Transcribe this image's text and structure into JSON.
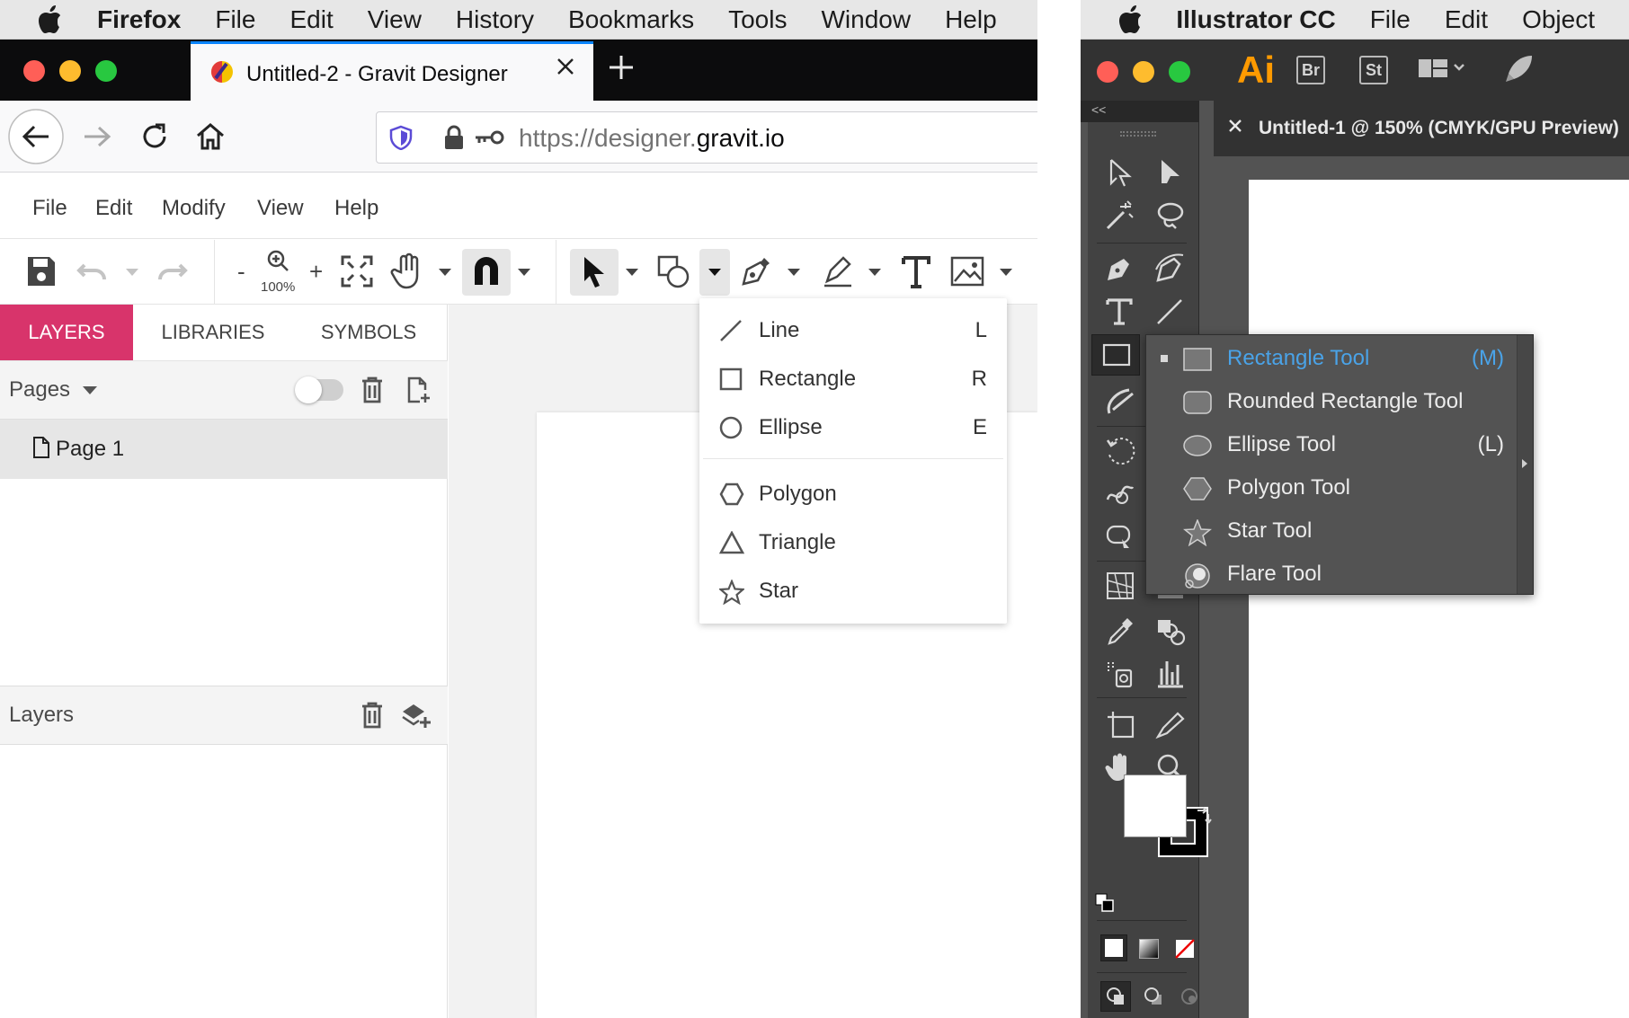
{
  "firefox": {
    "menubar": {
      "app": "Firefox",
      "items": [
        "File",
        "Edit",
        "View",
        "History",
        "Bookmarks",
        "Tools",
        "Window",
        "Help"
      ]
    },
    "tab": {
      "title": "Untitled-2 - Gravit Designer"
    },
    "url": {
      "prefix": "https://designer.",
      "domain": "gravit.io"
    }
  },
  "gravit": {
    "menu": [
      "File",
      "Edit",
      "Modify",
      "View",
      "Help"
    ],
    "zoom": "100%",
    "zoom_minus": "-",
    "zoom_plus": "+",
    "panel_tabs": [
      "LAYERS",
      "LIBRARIES",
      "SYMBOLS"
    ],
    "pages_label": "Pages",
    "page_item": "Page 1",
    "layers_label": "Layers",
    "accent": "#d8346b",
    "shape_menu": [
      {
        "label": "Line",
        "key": "L",
        "icon": "line-icon"
      },
      {
        "label": "Rectangle",
        "key": "R",
        "icon": "rectangle-icon"
      },
      {
        "label": "Ellipse",
        "key": "E",
        "icon": "ellipse-icon"
      },
      {
        "label": "Polygon",
        "key": "",
        "icon": "polygon-icon"
      },
      {
        "label": "Triangle",
        "key": "",
        "icon": "triangle-icon"
      },
      {
        "label": "Star",
        "key": "",
        "icon": "star-icon"
      }
    ]
  },
  "illustrator": {
    "menubar": {
      "app": "Illustrator CC",
      "items": [
        "File",
        "Edit",
        "Object"
      ]
    },
    "appbar": {
      "logo": "Ai",
      "bridge": "Br",
      "stock": "St"
    },
    "collapse": "<<",
    "doc_tab": "Untitled-1 @ 150% (CMYK/GPU Preview)",
    "flyout": [
      {
        "label": "Rectangle Tool",
        "key": "(M)",
        "icon": "rectangle-tool-icon"
      },
      {
        "label": "Rounded Rectangle Tool",
        "key": "",
        "icon": "rounded-rectangle-tool-icon"
      },
      {
        "label": "Ellipse Tool",
        "key": "(L)",
        "icon": "ellipse-tool-icon"
      },
      {
        "label": "Polygon Tool",
        "key": "",
        "icon": "polygon-tool-icon"
      },
      {
        "label": "Star Tool",
        "key": "",
        "icon": "star-tool-icon"
      },
      {
        "label": "Flare Tool",
        "key": "",
        "icon": "flare-tool-icon"
      }
    ],
    "selected_color": "#4aa3e8"
  }
}
